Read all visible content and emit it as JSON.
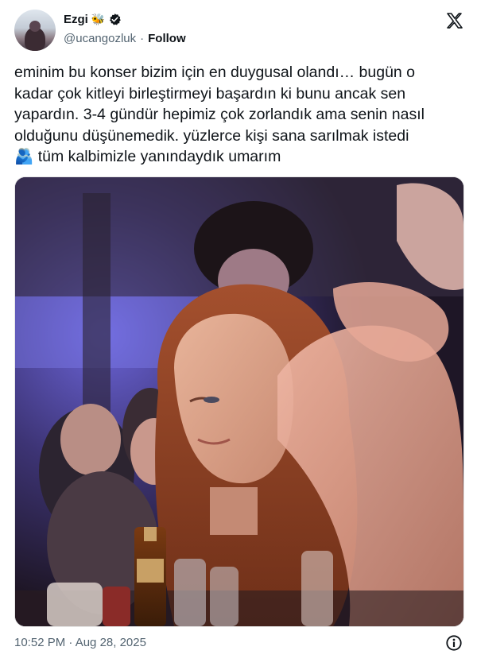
{
  "author": {
    "name": "Ezgi",
    "name_emoji": "🐝",
    "handle": "@ucangozluk",
    "separator": "·",
    "follow_label": "Follow"
  },
  "tweet": {
    "lines": [
      "eminim bu konser bizim için en duygusal olandı… bugün o",
      "kadar çok kitleyi birleştirmeyi başardın ki bunu ancak sen",
      "yapardın. 3-4 gündür hepimiz çok zorlandık ama senin nasıl",
      "olduğunu düşünemedik. yüzlerce kişi sana sarılmak istedi",
      "🫂 tüm kalbimizle yanındaydık umarım"
    ]
  },
  "footer": {
    "timestamp": "10:52 PM · Aug 28, 2025"
  },
  "icons": {
    "verified": "verified-badge-icon",
    "platform": "x-logo-icon",
    "info": "info-icon"
  },
  "colors": {
    "text": "#0f1419",
    "secondary": "#536471"
  }
}
